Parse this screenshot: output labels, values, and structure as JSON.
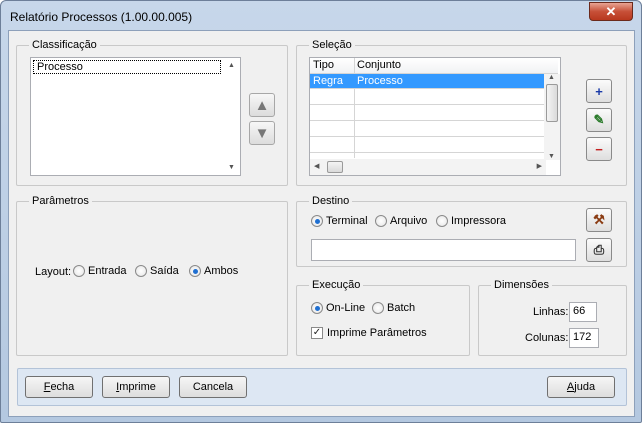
{
  "window": {
    "title": "Relatório Processos (1.00.00.005)",
    "close_symbol": "✕"
  },
  "classificacao": {
    "label": "Classificação",
    "items": [
      "Processo"
    ]
  },
  "selecao": {
    "label": "Seleção",
    "columns": [
      "Tipo",
      "Conjunto"
    ],
    "rows": [
      {
        "tipo": "Regra",
        "conjunto": "Processo"
      }
    ]
  },
  "parametros": {
    "label": "Parâmetros",
    "layout_label": "Layout:",
    "options": [
      "Entrada",
      "Saída",
      "Ambos"
    ],
    "selected": "Ambos"
  },
  "destino": {
    "label": "Destino",
    "options": [
      "Terminal",
      "Arquivo",
      "Impressora"
    ],
    "selected": "Terminal",
    "path_value": ""
  },
  "execucao": {
    "label": "Execução",
    "options": [
      "On-Line",
      "Batch"
    ],
    "selected": "On-Line",
    "imprime_label": "Imprime Parâmetros",
    "imprime_checked": true
  },
  "dimensoes": {
    "label": "Dimensões",
    "linhas_label": "Linhas:",
    "linhas_value": "66",
    "colunas_label": "Colunas:",
    "colunas_value": "172"
  },
  "buttons": {
    "fecha_first": "F",
    "fecha_rest": "echa",
    "imprime_first": "I",
    "imprime_rest": "mprime",
    "cancela": "Cancela",
    "ajuda_first": "A",
    "ajuda_rest": "juda"
  },
  "colors": {
    "selection": "#3399ff",
    "accent": "#1f6fd1"
  }
}
